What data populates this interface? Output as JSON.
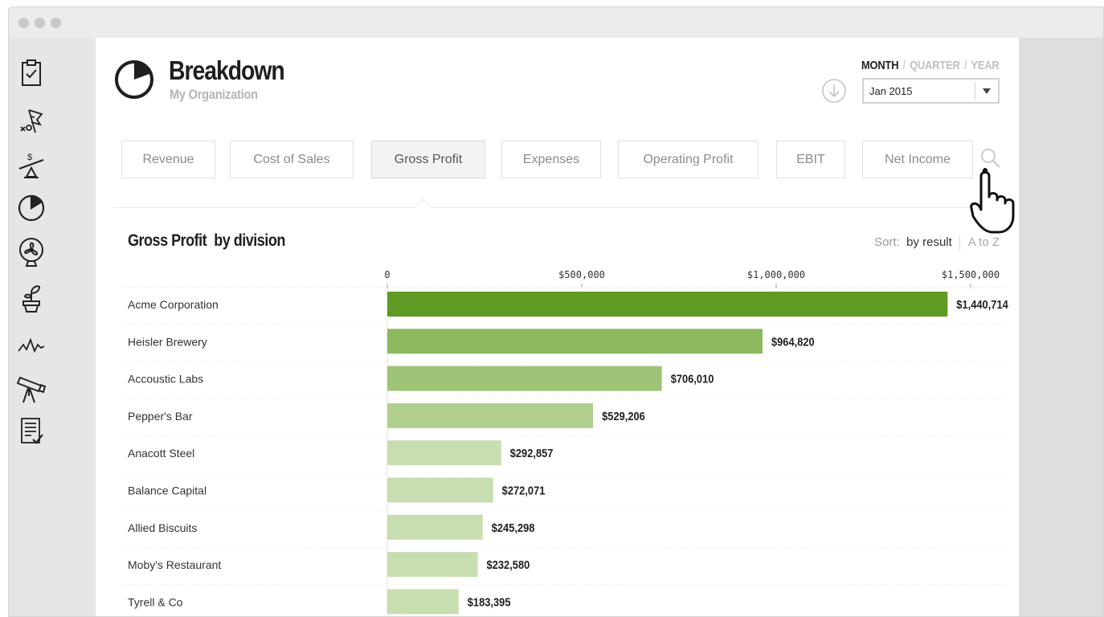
{
  "header": {
    "title": "Breakdown",
    "subtitle": "My Organization",
    "period_options": [
      "MONTH",
      "QUARTER",
      "YEAR"
    ],
    "period_active": "MONTH",
    "period_value": "Jan 2015"
  },
  "sidebar": {
    "items": [
      {
        "icon": "clipboard-check-icon"
      },
      {
        "icon": "strategy-flag-icon"
      },
      {
        "icon": "balance-dollar-icon"
      },
      {
        "icon": "pie-chart-icon"
      },
      {
        "icon": "fan-icon"
      },
      {
        "icon": "plant-pot-icon"
      },
      {
        "icon": "pulse-icon"
      },
      {
        "icon": "telescope-icon"
      },
      {
        "icon": "report-check-icon"
      }
    ]
  },
  "tabs": [
    {
      "label": "Revenue",
      "active": false
    },
    {
      "label": "Cost of Sales",
      "active": false
    },
    {
      "label": "Gross Profit",
      "active": true
    },
    {
      "label": "Expenses",
      "active": false
    },
    {
      "label": "Operating Profit",
      "active": false
    },
    {
      "label": "EBIT",
      "active": false
    },
    {
      "label": "Net Income",
      "active": false
    }
  ],
  "section": {
    "title_main": "Gross Profit",
    "title_suffix": "by division",
    "sort_label": "Sort:",
    "sort_options": [
      "by result",
      "A to Z"
    ],
    "sort_active": "by result"
  },
  "colors": {
    "bar_top": "#5e9a24",
    "bar_mid": "#8cb95f",
    "bar_light": "#c7deb0"
  },
  "chart_data": {
    "type": "bar",
    "orientation": "horizontal",
    "categories": [
      "Acme Corporation",
      "Heisler Brewery",
      "Accoustic Labs",
      "Pepper's Bar",
      "Anacott Steel",
      "Balance Capital",
      "Allied Biscuits",
      "Moby's Restaurant",
      "Tyrell & Co"
    ],
    "values": [
      1440714,
      964820,
      706010,
      529206,
      292857,
      272071,
      245298,
      232580,
      183395
    ],
    "value_labels": [
      "$1,440,714",
      "$964,820",
      "$706,010",
      "$529,206",
      "$292,857",
      "$272,071",
      "$245,298",
      "$232,580",
      "$183,395"
    ],
    "xlim": [
      0,
      1600000
    ],
    "xticks": [
      0,
      500000,
      1000000,
      1500000
    ],
    "xtick_labels": [
      "0",
      "$500,000",
      "$1,000,000",
      "$1,500,000"
    ]
  }
}
